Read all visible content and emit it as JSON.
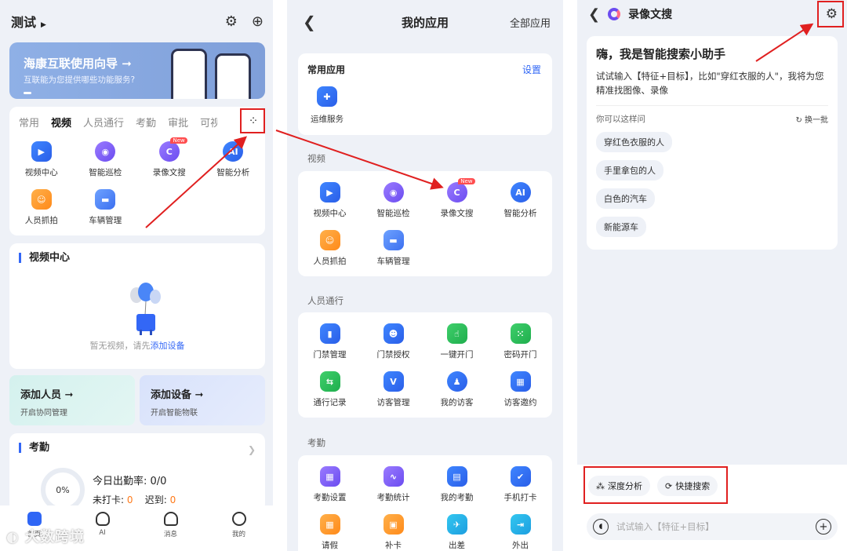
{
  "colors": {
    "accent": "#2f66f5",
    "highlight": "#e02020",
    "watermark": "#ffffff"
  },
  "home": {
    "title": "测试",
    "banner": {
      "title": "海康互联使用向导 ➞",
      "subtitle": "互联能为您提供哪些功能服务?"
    },
    "tabs": [
      "常用",
      "视频",
      "人员通行",
      "考勤",
      "审批",
      "可视"
    ],
    "apps": [
      {
        "label": "视频中心",
        "icon": "video-center-icon"
      },
      {
        "label": "智能巡检",
        "icon": "smart-patrol-icon"
      },
      {
        "label": "录像文搜",
        "icon": "video-text-search-icon",
        "badge": "New"
      },
      {
        "label": "智能分析",
        "icon": "ai-analysis-icon"
      },
      {
        "label": "人员抓拍",
        "icon": "person-capture-icon"
      },
      {
        "label": "车辆管理",
        "icon": "vehicle-management-icon"
      }
    ],
    "video_section": {
      "title": "视频中心",
      "empty_text": "暂无视频，请先",
      "empty_link": "添加设备"
    },
    "quick": [
      {
        "title": "添加人员 ➞",
        "subtitle": "开启协同管理"
      },
      {
        "title": "添加设备 ➞",
        "subtitle": "开启智能物联"
      }
    ],
    "attendance": {
      "title": "考勤",
      "ring": "0%",
      "rate_label": "今日出勤率: ",
      "rate_value": "0/0",
      "absent_label": "未打卡: ",
      "absent_value": "0",
      "late_label": "迟到: ",
      "late_value": "0"
    },
    "tabbar": [
      "首页",
      "AI",
      "消息",
      "我的"
    ],
    "watermark": "大数跨境"
  },
  "apps_page": {
    "title": "我的应用",
    "all": "全部应用",
    "favorites": {
      "title": "常用应用",
      "settings": "设置",
      "item": "运维服务"
    },
    "groups": [
      {
        "title": "视频",
        "items": [
          "视频中心",
          "智能巡检",
          "录像文搜",
          "智能分析",
          "人员抓拍",
          "车辆管理"
        ]
      },
      {
        "title": "人员通行",
        "items": [
          "门禁管理",
          "门禁授权",
          "一键开门",
          "密码开门",
          "通行记录",
          "访客管理",
          "我的访客",
          "访客邀约"
        ]
      },
      {
        "title": "考勤",
        "items": [
          "考勤设置",
          "考勤统计",
          "我的考勤",
          "手机打卡",
          "请假",
          "补卡",
          "出差",
          "外出"
        ]
      }
    ]
  },
  "search_page": {
    "title": "录像文搜",
    "greeting": "嗨，我是智能搜索小助手",
    "tip": "试试输入【特征+目标】，比如\"穿红衣服的人\"，我将为您精准找图像、录像",
    "ask": "你可以这样问",
    "swap": "换一批",
    "suggestions": [
      "穿红色衣服的人",
      "手里拿包的人",
      "白色的汽车",
      "新能源车"
    ],
    "modes": [
      "深度分析",
      "快捷搜索"
    ],
    "input_placeholder": "试试输入【特征+目标】"
  }
}
